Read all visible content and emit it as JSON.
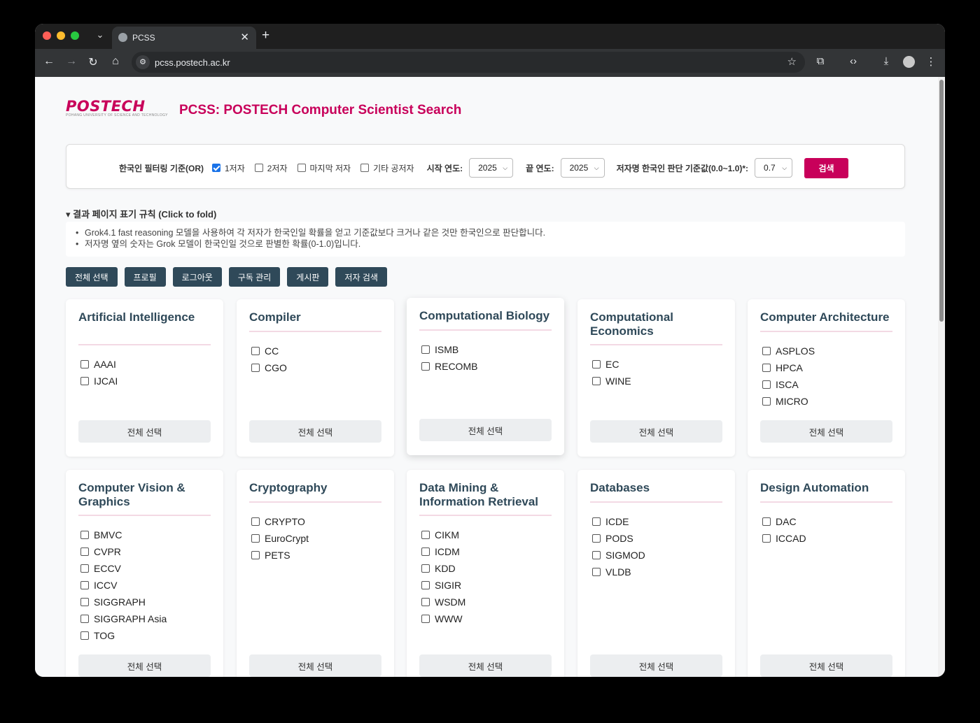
{
  "browser": {
    "tab_title": "PCSS",
    "url": "pcss.postech.ac.kr",
    "tab_menu_icon": "chevron-down-icon",
    "close_glyph": "✕",
    "new_tab_glyph": "+"
  },
  "header": {
    "logo_text": "POSTECH",
    "logo_subtext": "POHANG UNIVERSITY OF SCIENCE AND TECHNOLOGY",
    "title": "PCSS: POSTECH Computer Scientist Search"
  },
  "filter": {
    "korean_filter_label": "한국인 필터링 기준(OR)",
    "options": [
      {
        "label": "1저자",
        "checked": true
      },
      {
        "label": "2저자",
        "checked": false
      },
      {
        "label": "마지막 저자",
        "checked": false
      },
      {
        "label": "기타 공저자",
        "checked": false
      }
    ],
    "start_year_label": "시작 연도:",
    "start_year_value": "2025",
    "end_year_label": "끝 연도:",
    "end_year_value": "2025",
    "threshold_label": "저자명 한국인 판단 기준값(0.0~1.0)*:",
    "threshold_value": "0.7",
    "search_button": "검색"
  },
  "rules": {
    "toggle_label": "▾ 결과 페이지 표기 규칙 (Click to fold)",
    "items": [
      "Grok4.1 fast reasoning 모델을 사용하여 각 저자가 한국인일 확률을 얻고 기준값보다 크거나 같은 것만 한국인으로 판단합니다.",
      "저자명 옆의 숫자는 Grok 모델이 한국인일 것으로 판별한 확률(0-1.0)입니다."
    ]
  },
  "actions": [
    "전체 선택",
    "프로필",
    "로그아웃",
    "구독 관리",
    "게시판",
    "저자 검색"
  ],
  "select_all_label": "전체 선택",
  "categories": [
    {
      "title": "Artificial Intelligence",
      "venues": [
        "AAAI",
        "IJCAI"
      ]
    },
    {
      "title": "Compiler",
      "venues": [
        "CC",
        "CGO"
      ]
    },
    {
      "title": "Computational Biology",
      "venues": [
        "ISMB",
        "RECOMB"
      ]
    },
    {
      "title": "Computational Economics",
      "venues": [
        "EC",
        "WINE"
      ]
    },
    {
      "title": "Computer Architecture",
      "venues": [
        "ASPLOS",
        "HPCA",
        "ISCA",
        "MICRO"
      ]
    },
    {
      "title": "Computer Vision & Graphics",
      "venues": [
        "BMVC",
        "CVPR",
        "ECCV",
        "ICCV",
        "SIGGRAPH",
        "SIGGRAPH Asia",
        "TOG"
      ]
    },
    {
      "title": "Cryptography",
      "venues": [
        "CRYPTO",
        "EuroCrypt",
        "PETS"
      ]
    },
    {
      "title": "Data Mining & Information Retrieval",
      "venues": [
        "CIKM",
        "ICDM",
        "KDD",
        "SIGIR",
        "WSDM",
        "WWW"
      ]
    },
    {
      "title": "Databases",
      "venues": [
        "ICDE",
        "PODS",
        "SIGMOD",
        "VLDB"
      ]
    },
    {
      "title": "Design Automation",
      "venues": [
        "DAC",
        "ICCAD"
      ]
    }
  ]
}
